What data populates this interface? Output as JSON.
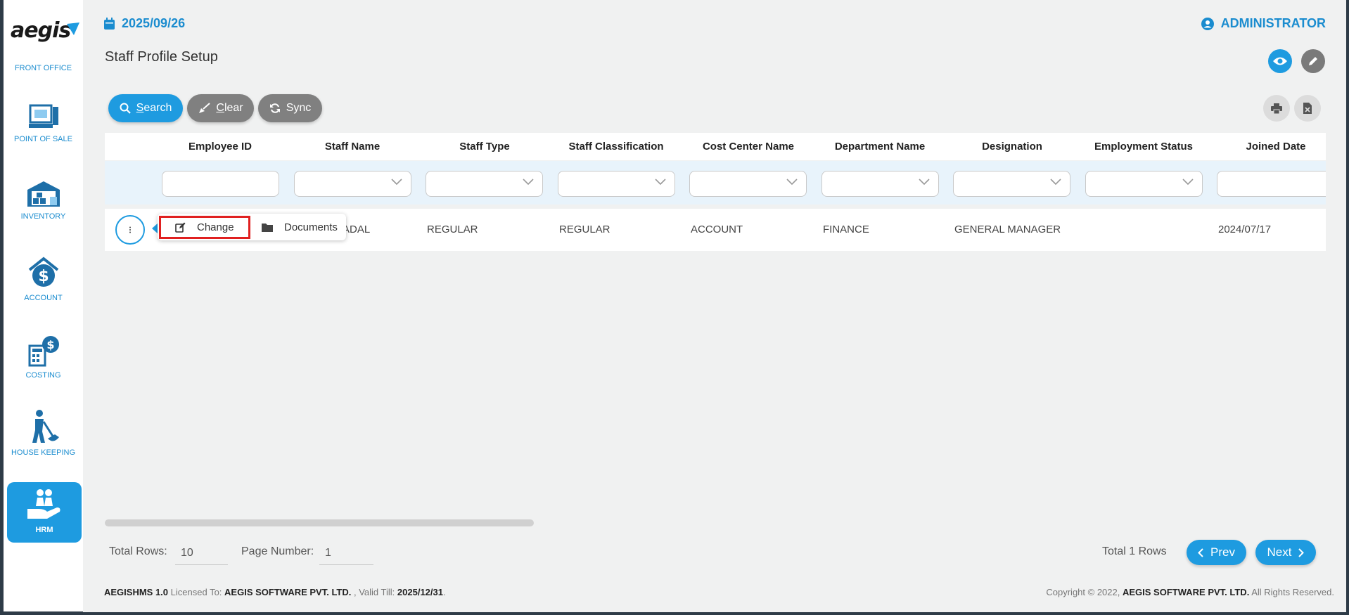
{
  "app": {
    "logo_text": "aegis"
  },
  "header": {
    "date": "2025/09/26",
    "user": "ADMINISTRATOR",
    "page_title": "Staff Profile Setup"
  },
  "sidebar": {
    "items": [
      {
        "label": "FRONT OFFICE",
        "icon": "front-office-icon"
      },
      {
        "label": "POINT OF SALE",
        "icon": "pos-icon"
      },
      {
        "label": "INVENTORY",
        "icon": "warehouse-icon"
      },
      {
        "label": "ACCOUNT",
        "icon": "money-house-icon"
      },
      {
        "label": "COSTING",
        "icon": "calculator-icon"
      },
      {
        "label": "HOUSE KEEPING",
        "icon": "cleaner-icon"
      },
      {
        "label": "HRM",
        "icon": "hand-people-icon",
        "active": true
      }
    ]
  },
  "toolbar": {
    "search_label": "Search",
    "search_underline": "S",
    "search_rest": "earch",
    "clear_underline": "C",
    "clear_rest": "lear",
    "sync_label": "Sync"
  },
  "grid": {
    "columns": [
      "Employee ID",
      "Staff Name",
      "Staff Type",
      "Staff Classification",
      "Cost Center Name",
      "Department Name",
      "Designation",
      "Employment Status",
      "Joined Date"
    ],
    "row": {
      "staff_name_partial": "ADAL",
      "staff_type": "REGULAR",
      "classification": "REGULAR",
      "cost_center": "ACCOUNT",
      "department": "FINANCE",
      "designation": "GENERAL MANAGER",
      "employment_status": "",
      "joined_date": "2024/07/17"
    }
  },
  "context_menu": {
    "change": "Change",
    "documents": "Documents"
  },
  "paging": {
    "total_rows_label": "Total Rows:",
    "total_rows_value": "10",
    "page_number_label": "Page Number:",
    "page_number_value": "1",
    "summary": "Total 1 Rows",
    "prev": "Prev",
    "next": "Next"
  },
  "footer": {
    "product": "AEGISHMS 1.0",
    "licensed_to_label": "Licensed To:",
    "licensee": "AEGIS SOFTWARE PVT. LTD.",
    "valid_till_label": ", Valid Till:",
    "valid_till": "2025/12/31",
    "copyright_label": "Copyright © 2022,",
    "company": "AEGIS SOFTWARE PVT. LTD.",
    "rights": "All Rights Reserved."
  },
  "colors": {
    "accent": "#1e9be0",
    "grey_button": "#808080",
    "highlight": "#e02020"
  }
}
